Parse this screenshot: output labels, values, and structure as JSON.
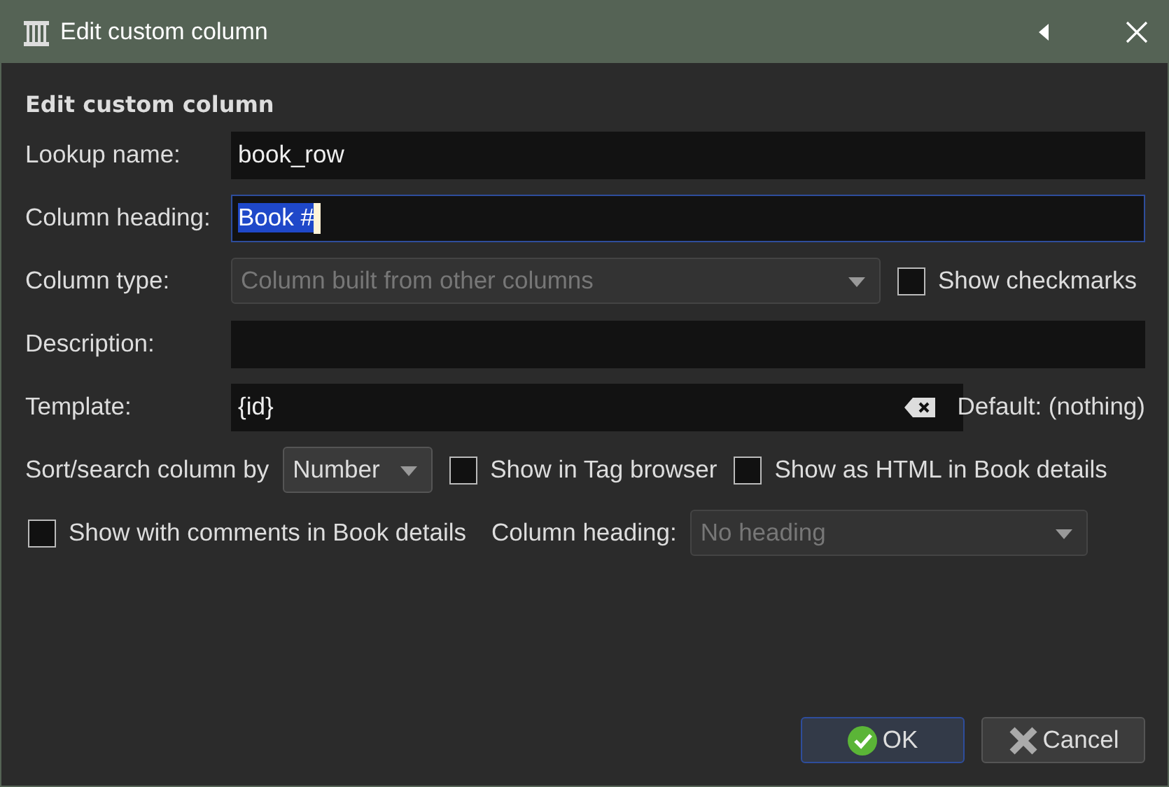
{
  "window": {
    "title": "Edit custom column"
  },
  "heading": "Edit custom column",
  "lookup": {
    "label": "Lookup name:",
    "value": "book_row",
    "focused": false
  },
  "column_heading": {
    "label": "Column heading:",
    "value": "Book #",
    "focused": true
  },
  "column_type": {
    "label": "Column type:",
    "value": "Column built from other columns",
    "disabled": true
  },
  "show_checkmarks": {
    "label": "Show checkmarks",
    "checked": false
  },
  "description": {
    "label": "Description:",
    "focused": false
  },
  "template": {
    "label": "Template:",
    "value": "{id}",
    "default": "Default: (nothing)"
  },
  "sort": {
    "label": "Sort/search column by",
    "value": "Number",
    "disabled": false
  },
  "show_tag_browser": {
    "label": "Show in Tag browser",
    "checked": false
  },
  "show_html": {
    "label": "Show as HTML in Book details",
    "checked": false
  },
  "show_comments": {
    "label": "Show with comments in Book details",
    "checked": false
  },
  "heading_position": {
    "label": "Column heading:",
    "value": "No heading",
    "disabled": true
  },
  "buttons": [
    {
      "label": "OK",
      "kind": "ok",
      "default": true
    },
    {
      "label": "Cancel",
      "kind": "cancel",
      "default": false
    }
  ]
}
